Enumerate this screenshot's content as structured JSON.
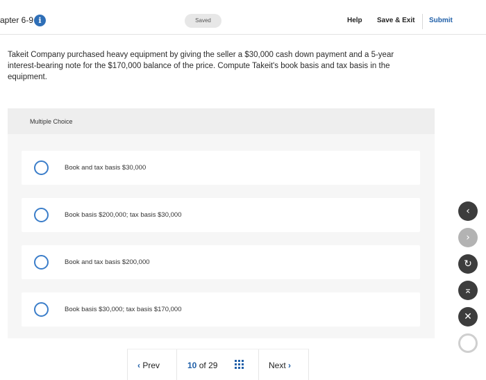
{
  "header": {
    "chapter": "apter 6-9",
    "info_icon": "info-icon",
    "status_pill": "Saved",
    "help": "Help",
    "save_exit": "Save & Exit",
    "submit": "Submit"
  },
  "question": {
    "text": "Takeit Company purchased heavy equipment by giving the seller a $30,000 cash down payment and a 5-year interest-bearing note for the $170,000 balance of the price. Compute Takeit's book basis and tax basis in the equipment."
  },
  "choices": {
    "title": "Multiple Choice",
    "options": [
      "Book and tax basis $30,000",
      "Book basis $200,000; tax basis $30,000",
      "Book and tax basis $200,000",
      "Book basis $30,000; tax basis $170,000"
    ]
  },
  "footer": {
    "prev": "Prev",
    "current": "10",
    "of": "of",
    "total": "29",
    "next": "Next",
    "grid_icon": "grid-icon"
  },
  "side_buttons": {
    "icons": [
      "chevron-left-icon",
      "chevron-right-icon",
      "refresh-icon",
      "collapse-up-icon",
      "close-icon",
      "ring-icon"
    ]
  },
  "colors": {
    "accent": "#1f5fa8",
    "radio": "#3a7dc9",
    "panel_bg": "#f6f6f6",
    "fab_dark": "#3d3d3d",
    "fab_light": "#b3b3b3"
  }
}
